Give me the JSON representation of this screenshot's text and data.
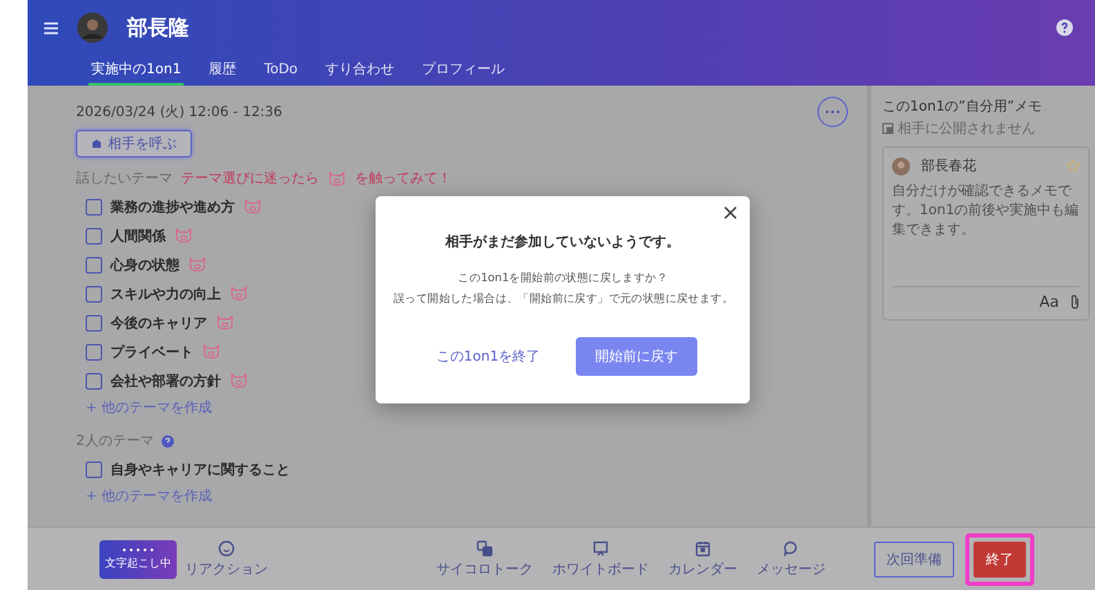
{
  "header": {
    "user_name": "部長隆",
    "tabs": [
      {
        "label": "実施中の1on1",
        "selected": true
      },
      {
        "label": "履歴",
        "selected": false
      },
      {
        "label": "ToDo",
        "selected": false
      },
      {
        "label": "すり合わせ",
        "selected": false
      },
      {
        "label": "プロフィール",
        "selected": false
      }
    ]
  },
  "session": {
    "date": "2026/03/24 (火) 12:06 - 12:36",
    "call_button": "相手を呼ぶ",
    "themes": {
      "label": "話したいテーマ",
      "hint": "テーマ選びに迷ったら",
      "hint_tail": "を触ってみて！",
      "items": [
        {
          "label": "業務の進捗や進め方",
          "checked": false
        },
        {
          "label": "人間関係",
          "checked": false
        },
        {
          "label": "心身の状態",
          "checked": false
        },
        {
          "label": "スキルや力の向上",
          "checked": false
        },
        {
          "label": "今後のキャリア",
          "checked": false
        },
        {
          "label": "プライベート",
          "checked": false
        },
        {
          "label": "会社や部署の方針",
          "checked": false
        }
      ],
      "add_link": "+ 他のテーマを作成"
    },
    "shared_themes": {
      "label": "2人のテーマ",
      "items": [
        {
          "label": "自身やキャリアに関すること",
          "checked": false
        }
      ],
      "add_link": "+ 他のテーマを作成"
    }
  },
  "memo": {
    "title": "この1on1の”自分用”メモ",
    "note": "相手に公開されません",
    "author": "部長春花",
    "placeholder": "自分だけが確認できるメモです。1on1の前後や実施中も編集できます。",
    "format_button": "Aa"
  },
  "footer": {
    "transcription": "文字起こし中",
    "reaction": "リアクション",
    "tools": [
      {
        "kind": "dice",
        "label": "サイコロトーク"
      },
      {
        "kind": "board",
        "label": "ホワイトボード"
      },
      {
        "kind": "calendar",
        "label": "カレンダー"
      },
      {
        "kind": "message",
        "label": "メッセージ"
      }
    ],
    "next_button": "次回準備",
    "end_button": "終了",
    "end_highlighted": true
  },
  "modal": {
    "title": "相手がまだ参加していないようです。",
    "lines": [
      "この1on1を開始前の状態に戻しますか？",
      "誤って開始した場合は、「開始前に戻す」で元の状態に戻せます。"
    ],
    "cancel": "この1on1を終了",
    "confirm": "開始前に戻す"
  }
}
